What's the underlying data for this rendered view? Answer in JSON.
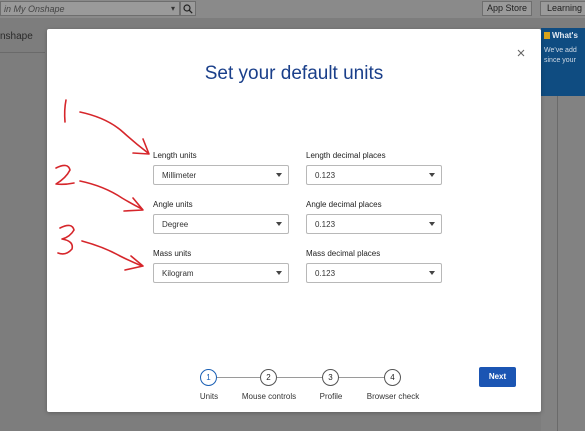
{
  "background": {
    "search_placeholder": "in My Onshape",
    "app_store_label": "App Store",
    "learning_label": "Learning C",
    "brand_text": "nshape",
    "notice_title": "What's",
    "notice_body_1": "We've add",
    "notice_body_2": "since your"
  },
  "modal": {
    "title": "Set your default units",
    "fields": [
      {
        "label": "Length units",
        "value": "Millimeter"
      },
      {
        "label": "Length decimal places",
        "value": "0.123"
      },
      {
        "label": "Angle units",
        "value": "Degree"
      },
      {
        "label": "Angle decimal places",
        "value": "0.123"
      },
      {
        "label": "Mass units",
        "value": "Kilogram"
      },
      {
        "label": "Mass decimal places",
        "value": "0.123"
      }
    ],
    "steps": [
      {
        "number": "1",
        "label": "Units",
        "active": true
      },
      {
        "number": "2",
        "label": "Mouse controls",
        "active": false
      },
      {
        "number": "3",
        "label": "Profile",
        "active": false
      },
      {
        "number": "4",
        "label": "Browser check",
        "active": false
      }
    ],
    "next_label": "Next"
  },
  "annotations": {
    "marks": [
      "1",
      "2",
      "3"
    ],
    "color": "#d6262b"
  },
  "colors": {
    "title": "#1a3f8a",
    "primary_button": "#1b55b3",
    "overlay": "#7d7d7d",
    "notice": "#0f4c81"
  }
}
